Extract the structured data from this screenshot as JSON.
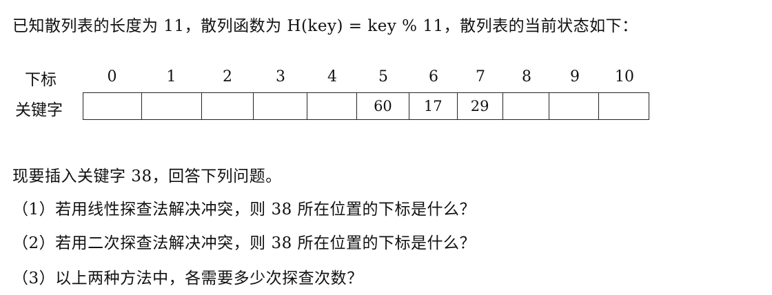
{
  "intro": "已知散列表的长度为 11，散列函数为 H(key) = key % 11，散列表的当前状态如下：",
  "table": {
    "index_label": "下标",
    "key_label": "关键字",
    "indices": [
      "0",
      "1",
      "2",
      "3",
      "4",
      "5",
      "6",
      "7",
      "8",
      "9",
      "10"
    ],
    "keys": [
      "",
      "",
      "",
      "",
      "",
      "60",
      "17",
      "29",
      "",
      "",
      ""
    ]
  },
  "prompt": "现要插入关键字 38，回答下列问题。",
  "questions": [
    "（1）若用线性探查法解决冲突，则 38 所在位置的下标是什么？",
    "（2）若用二次探查法解决冲突，则 38 所在位置的下标是什么？",
    "（3）以上两种方法中，各需要多少次探查次数？"
  ]
}
